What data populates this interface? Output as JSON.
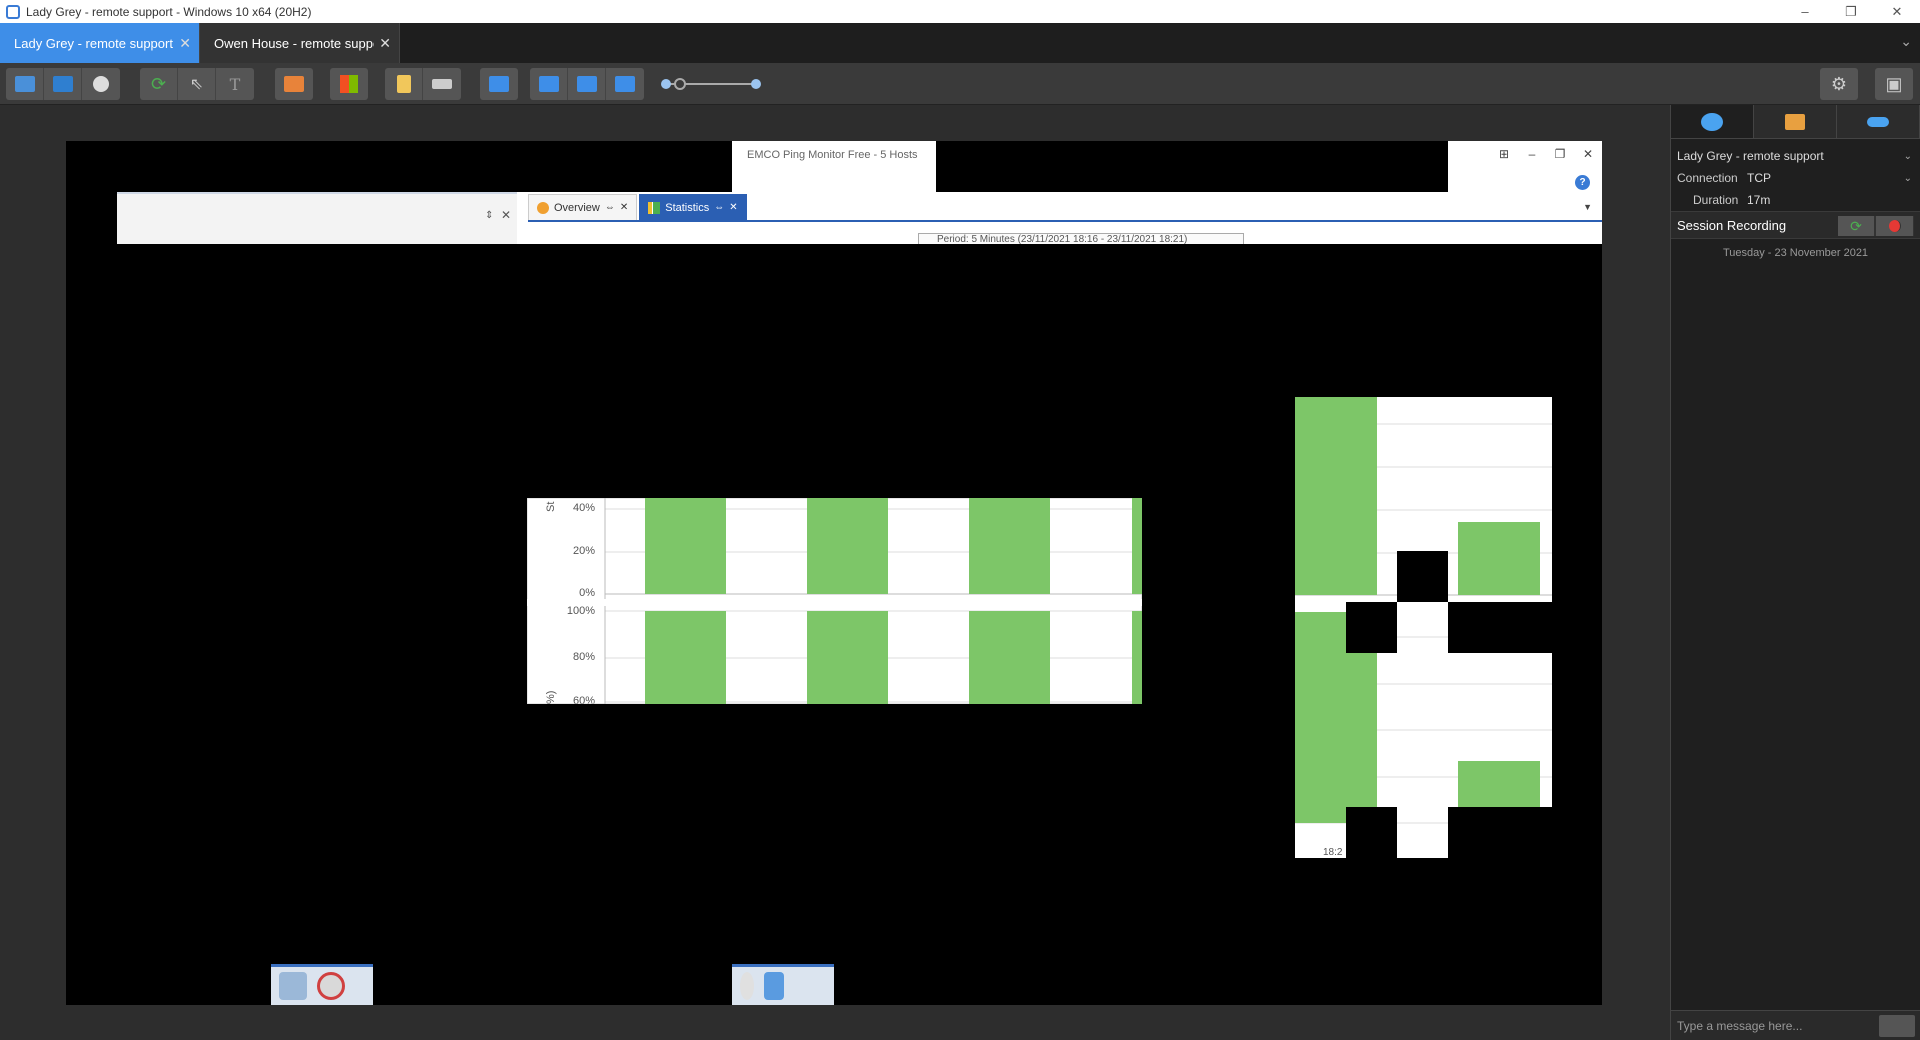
{
  "window": {
    "title": "Lady Grey - remote support - Windows 10 x64 (20H2)",
    "minimize": "–",
    "restore": "❐",
    "close": "✕"
  },
  "tabs": [
    {
      "label": "Lady Grey - remote support",
      "active": true,
      "close": "✕"
    },
    {
      "label": "Owen House - remote support",
      "active": false,
      "close": "✕"
    }
  ],
  "tab_overflow": "⌄",
  "remote": {
    "emco_title": "EMCO Ping Monitor Free - 5 Hosts",
    "doc_tabs": [
      {
        "label": "Overview",
        "pin": "⇔",
        "close": "✕"
      },
      {
        "label": "Statistics",
        "pin": "⇔",
        "close": "✕"
      }
    ],
    "period": "Period: 5 Minutes (23/11/2021 18:16 - 23/11/2021 18:21)",
    "chart1_ticks_top": [
      "40%",
      "20%",
      "0%"
    ],
    "chart1_ticks_bottom": [
      "100%",
      "80%",
      "60%"
    ],
    "chart1_axis_title_top": "St",
    "chart1_axis_title_bottom": "%)",
    "chart2_tick": "18:2"
  },
  "side_panel": {
    "session_name": "Lady Grey - remote support",
    "connection_label": "Connection",
    "connection_value": "TCP",
    "duration_label": "Duration",
    "duration_value": "17m",
    "recording_label": "Session Recording",
    "date": "Tuesday  -  23 November 2021",
    "message_placeholder": "Type a message here..."
  },
  "colors": {
    "accent": "#3e8ee8",
    "chart_green": "#7dc668",
    "record_red": "#e53935"
  }
}
